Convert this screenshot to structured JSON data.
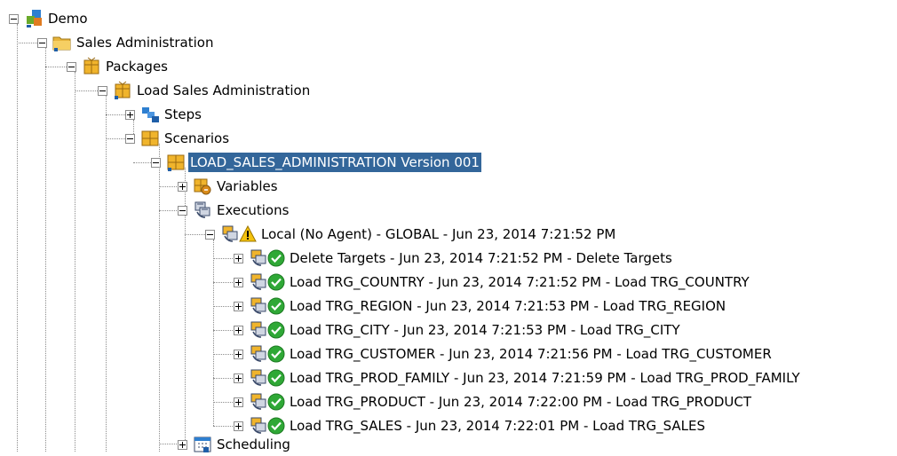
{
  "tree": {
    "root": "Demo",
    "folder": "Sales Administration",
    "packages": "Packages",
    "package": "Load Sales Administration",
    "steps": "Steps",
    "scenarios": "Scenarios",
    "scenario": "LOAD_SALES_ADMINISTRATION Version 001",
    "variables": "Variables",
    "executions": "Executions",
    "session": "Local (No Agent) - GLOBAL - Jun 23, 2014 7:21:52 PM",
    "tasks": [
      "Delete Targets - Jun 23, 2014 7:21:52 PM - Delete Targets",
      "Load TRG_COUNTRY - Jun 23, 2014 7:21:52 PM - Load TRG_COUNTRY",
      "Load TRG_REGION - Jun 23, 2014 7:21:53 PM - Load TRG_REGION",
      "Load TRG_CITY - Jun 23, 2014 7:21:53 PM - Load TRG_CITY",
      "Load TRG_CUSTOMER - Jun 23, 2014 7:21:56 PM - Load TRG_CUSTOMER",
      "Load TRG_PROD_FAMILY - Jun 23, 2014 7:21:59 PM - Load TRG_PROD_FAMILY",
      "Load TRG_PRODUCT - Jun 23, 2014 7:22:00 PM - Load TRG_PRODUCT",
      "Load TRG_SALES - Jun 23, 2014 7:22:01 PM - Load TRG_SALES"
    ],
    "scheduling": "Scheduling"
  },
  "colors": {
    "selection": "#33669a",
    "success": "#2fa836",
    "warning": "#f4c20d"
  }
}
